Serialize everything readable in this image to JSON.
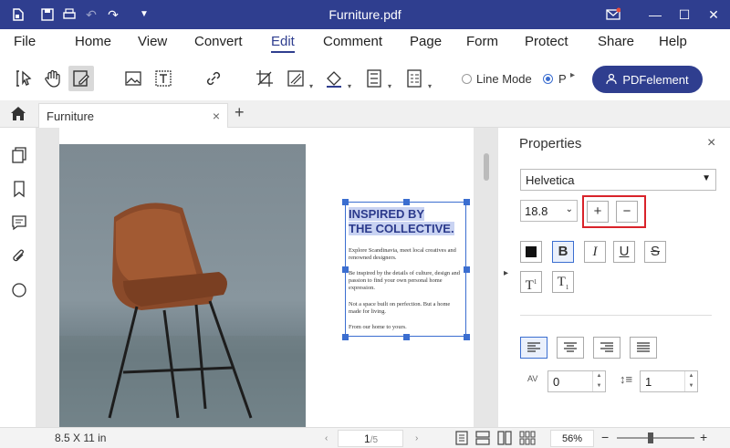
{
  "window": {
    "title": "Furniture.pdf"
  },
  "menu": [
    "File",
    "Home",
    "View",
    "Convert",
    "Edit",
    "Comment",
    "Page",
    "Form",
    "Protect",
    "Share",
    "Help"
  ],
  "toolbar": {
    "line_mode": "Line Mode",
    "paragraph_mode": "P",
    "pdfelement_button": "PDFelement"
  },
  "tab": {
    "name": "Furniture",
    "close": "×",
    "add": "+"
  },
  "document": {
    "headline_1": "INSPIRED BY",
    "headline_2": "THE COLLECTIVE.",
    "para_1": "Explore Scandinavia, meet local creatives and renowned designers.",
    "para_2": "Be inspired by the details of culture, design and passion to find your own personal home expression.",
    "para_3": "Not a space built on perfection. But a home made for living.",
    "para_4": "From our home to yours."
  },
  "properties": {
    "title": "Properties",
    "close": "×",
    "font": "Helvetica",
    "size": "18.8",
    "increase": "+",
    "decrease": "−",
    "char_spacing": "0",
    "line_spacing": "1",
    "text_color": "#111111",
    "formats": {
      "bold": "B",
      "italic": "I",
      "underline": "U",
      "strikethrough": "S",
      "superscript": "T",
      "subscript": "T"
    }
  },
  "status": {
    "page_size": "8.5 X 11 in",
    "current_page": "1",
    "total_pages": "/5",
    "zoom": "56%"
  },
  "colors": {
    "brand": "#2f3e8f",
    "selection": "#3b6ed0",
    "highlight_box": "#d9232a"
  }
}
